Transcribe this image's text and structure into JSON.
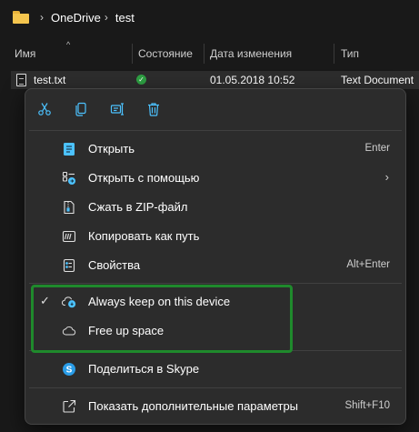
{
  "breadcrumb": {
    "items": [
      "OneDrive",
      "test"
    ]
  },
  "columns": {
    "name": "Имя",
    "status": "Состояние",
    "date": "Дата изменения",
    "type": "Тип"
  },
  "file": {
    "name": "test.txt",
    "status_icon": "synced-check-icon",
    "date": "01.05.2018 10:52",
    "type": "Text Document"
  },
  "toolbar": {
    "items": [
      "cut-icon",
      "copy-icon",
      "rename-icon",
      "delete-icon"
    ]
  },
  "menu": {
    "open": {
      "label": "Открыть",
      "shortcut": "Enter"
    },
    "open_with": {
      "label": "Открыть с помощью"
    },
    "zip": {
      "label": "Сжать в ZIP-файл"
    },
    "copy_path": {
      "label": "Копировать как путь"
    },
    "properties": {
      "label": "Свойства",
      "shortcut": "Alt+Enter"
    },
    "keep": {
      "label": "Always keep on this device",
      "checked": true
    },
    "free": {
      "label": "Free up space"
    },
    "skype": {
      "label": "Поделиться в Skype"
    },
    "more": {
      "label": "Показать дополнительные параметры",
      "shortcut": "Shift+F10"
    }
  },
  "colors": {
    "highlight_border": "#1f8a2c",
    "icon_blue": "#4cc2ff",
    "sync_green": "#2ea043"
  }
}
